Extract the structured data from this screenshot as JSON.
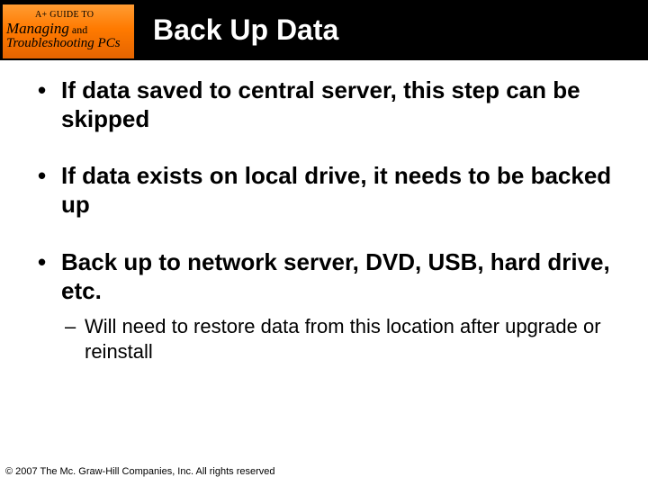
{
  "logo": {
    "line_top": "A+ GUIDE TO",
    "line_mid_a": "Managing",
    "line_mid_and": " and",
    "line_bot": "Troubleshooting PCs"
  },
  "title": "Back Up Data",
  "bullets": [
    {
      "text": "If data saved to central server, this step can be skipped"
    },
    {
      "text": "If data exists on local drive, it needs to be backed up"
    },
    {
      "text": "Back up to network server, DVD, USB, hard drive, etc.",
      "sub": [
        "Will need to restore data from this location after upgrade or reinstall"
      ]
    }
  ],
  "footer": "© 2007 The Mc. Graw-Hill Companies, Inc. All rights reserved"
}
